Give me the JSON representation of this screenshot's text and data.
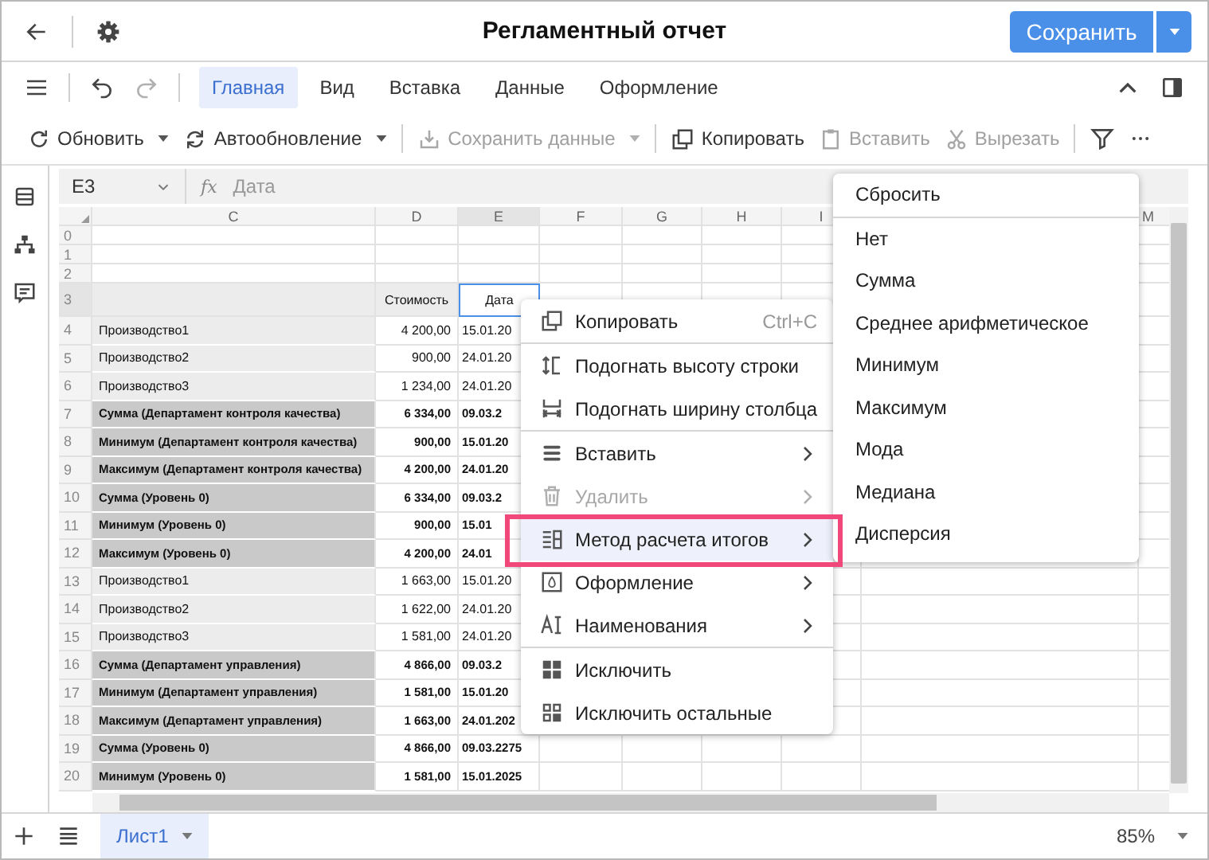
{
  "header": {
    "title": "Регламентный отчет",
    "save_button": "Сохранить"
  },
  "history": {
    "undo_disabled": false,
    "redo_disabled": true
  },
  "ribbon_tabs": [
    {
      "label": "Главная",
      "selected": true
    },
    {
      "label": "Вид",
      "selected": false
    },
    {
      "label": "Вставка",
      "selected": false
    },
    {
      "label": "Данные",
      "selected": false
    },
    {
      "label": "Оформление",
      "selected": false
    }
  ],
  "toolbar": [
    {
      "label": "Обновить",
      "disabled": false,
      "dropdown": true,
      "divider_after": false
    },
    {
      "label": "Автообновление",
      "disabled": false,
      "dropdown": true,
      "divider_after": true
    },
    {
      "label": "Сохранить данные",
      "disabled": true,
      "dropdown": true,
      "divider_after": true
    },
    {
      "label": "Копировать",
      "disabled": false,
      "dropdown": false,
      "divider_after": false
    },
    {
      "label": "Вставить",
      "disabled": true,
      "dropdown": false,
      "divider_after": false
    },
    {
      "label": "Вырезать",
      "disabled": true,
      "dropdown": false,
      "divider_after": true
    }
  ],
  "formula_bar": {
    "cell_ref": "E3",
    "function_label": "fx",
    "value": "Дата"
  },
  "grid": {
    "columns": [
      {
        "label": "C",
        "selected": false
      },
      {
        "label": "D",
        "selected": false
      },
      {
        "label": "E",
        "selected": true
      },
      {
        "label": "F",
        "selected": false
      },
      {
        "label": "G",
        "selected": false
      },
      {
        "label": "H",
        "selected": false
      },
      {
        "label": "I",
        "selected": false
      },
      {
        "label": "M",
        "selected": false
      }
    ],
    "rows": [
      {
        "number": "0",
        "kind": "empty",
        "selected": false,
        "cells": []
      },
      {
        "number": "1",
        "kind": "empty",
        "selected": false,
        "cells": []
      },
      {
        "number": "2",
        "kind": "empty",
        "selected": false,
        "cells": []
      },
      {
        "number": "3",
        "kind": "header",
        "selected": true,
        "cells": [
          "",
          "Стоимость",
          "Дата"
        ]
      },
      {
        "number": "4",
        "kind": "detail",
        "selected": false,
        "cells": [
          "Производство1",
          "4 200,00",
          "15.01.20"
        ]
      },
      {
        "number": "5",
        "kind": "detail",
        "selected": false,
        "cells": [
          "Производство2",
          "900,00",
          "24.01.20"
        ]
      },
      {
        "number": "6",
        "kind": "detail",
        "selected": false,
        "cells": [
          "Производство3",
          "1 234,00",
          "24.01.20"
        ]
      },
      {
        "number": "7",
        "kind": "total",
        "selected": false,
        "cells": [
          "Сумма (Департамент контроля качества)",
          "6 334,00",
          "09.03.2"
        ]
      },
      {
        "number": "8",
        "kind": "total",
        "selected": false,
        "cells": [
          "Минимум (Департамент контроля качества)",
          "900,00",
          "15.01.20"
        ]
      },
      {
        "number": "9",
        "kind": "total",
        "selected": false,
        "cells": [
          "Максимум (Департамент контроля качества)",
          "4 200,00",
          "24.01.20"
        ]
      },
      {
        "number": "10",
        "kind": "total",
        "selected": false,
        "cells": [
          "Сумма (Уровень 0)",
          "6 334,00",
          "09.03.2"
        ]
      },
      {
        "number": "11",
        "kind": "total",
        "selected": false,
        "cells": [
          "Минимум (Уровень 0)",
          "900,00",
          "15.01"
        ]
      },
      {
        "number": "12",
        "kind": "total",
        "selected": false,
        "cells": [
          "Максимум (Уровень 0)",
          "4 200,00",
          "24.01"
        ]
      },
      {
        "number": "13",
        "kind": "detail",
        "selected": false,
        "cells": [
          "Производство1",
          "1 663,00",
          "15.01.20"
        ]
      },
      {
        "number": "14",
        "kind": "detail",
        "selected": false,
        "cells": [
          "Производство2",
          "1 622,00",
          "24.01.20"
        ]
      },
      {
        "number": "15",
        "kind": "detail",
        "selected": false,
        "cells": [
          "Производство3",
          "1 581,00",
          "24.01.20"
        ]
      },
      {
        "number": "16",
        "kind": "total",
        "selected": false,
        "cells": [
          "Сумма (Департамент управления)",
          "4 866,00",
          "09.03.2"
        ]
      },
      {
        "number": "17",
        "kind": "total",
        "selected": false,
        "cells": [
          "Минимум (Департамент управления)",
          "1 581,00",
          "15.01.20"
        ]
      },
      {
        "number": "18",
        "kind": "total",
        "selected": false,
        "cells": [
          "Максимум (Департамент управления)",
          "1 663,00",
          "24.01.202"
        ]
      },
      {
        "number": "19",
        "kind": "total",
        "selected": false,
        "cells": [
          "Сумма (Уровень 0)",
          "4 866,00",
          "09.03.2275"
        ]
      },
      {
        "number": "20",
        "kind": "total",
        "selected": false,
        "cells": [
          "Минимум (Уровень 0)",
          "1 581,00",
          "15.01.2025"
        ]
      }
    ]
  },
  "context_menu": {
    "items": [
      {
        "label": "Копировать",
        "shortcut": "Ctrl+C",
        "submenu": false,
        "disabled": false,
        "highlighted": false,
        "outlined": false,
        "separator_after": true
      },
      {
        "label": "Подогнать высоту строки",
        "submenu": false,
        "disabled": false,
        "highlighted": false,
        "outlined": false,
        "separator_after": false
      },
      {
        "label": "Подогнать ширину столбца",
        "submenu": false,
        "disabled": false,
        "highlighted": false,
        "outlined": false,
        "separator_after": true
      },
      {
        "label": "Вставить",
        "submenu": true,
        "disabled": false,
        "highlighted": false,
        "outlined": false,
        "separator_after": false
      },
      {
        "label": "Удалить",
        "submenu": true,
        "disabled": true,
        "highlighted": false,
        "outlined": false,
        "separator_after": false
      },
      {
        "label": "Метод расчета итогов",
        "submenu": true,
        "disabled": false,
        "highlighted": true,
        "outlined": true,
        "separator_after": false
      },
      {
        "label": "Оформление",
        "submenu": true,
        "disabled": false,
        "highlighted": false,
        "outlined": false,
        "separator_after": false
      },
      {
        "label": "Наименования",
        "submenu": true,
        "disabled": false,
        "highlighted": false,
        "outlined": false,
        "separator_after": true
      },
      {
        "label": "Исключить",
        "submenu": false,
        "disabled": false,
        "highlighted": false,
        "outlined": false,
        "separator_after": false
      },
      {
        "label": "Исключить остальные",
        "submenu": false,
        "disabled": false,
        "highlighted": false,
        "outlined": false,
        "separator_after": false
      }
    ]
  },
  "submenu": {
    "items": [
      {
        "label": "Сбросить",
        "separator_after": true
      },
      {
        "label": "Нет",
        "separator_after": false
      },
      {
        "label": "Сумма",
        "separator_after": false
      },
      {
        "label": "Среднее арифметическое",
        "separator_after": false
      },
      {
        "label": "Минимум",
        "separator_after": false
      },
      {
        "label": "Максимум",
        "separator_after": false
      },
      {
        "label": "Мода",
        "separator_after": false
      },
      {
        "label": "Медиана",
        "separator_after": false
      },
      {
        "label": "Дисперсия",
        "separator_after": false
      }
    ]
  },
  "sheet_tabs": [
    {
      "label": "Лист1",
      "selected": true
    }
  ],
  "zoom": "85%"
}
